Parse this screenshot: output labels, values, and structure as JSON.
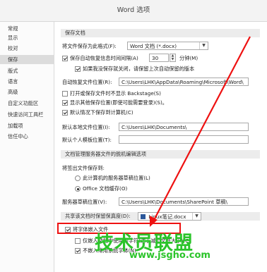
{
  "window": {
    "title": "Word 选项"
  },
  "sidebar": {
    "items": [
      {
        "label": "常规"
      },
      {
        "label": "显示"
      },
      {
        "label": "校对"
      },
      {
        "label": "保存"
      },
      {
        "label": "版式"
      },
      {
        "label": "语言"
      },
      {
        "label": "高级"
      },
      {
        "label": "自定义功能区"
      },
      {
        "label": "快速访问工具栏"
      },
      {
        "label": "加载项"
      },
      {
        "label": "信任中心"
      }
    ],
    "selected": "保存"
  },
  "save_docs": {
    "header": "保存文档",
    "format_label": "将文件保存为此格式(F):",
    "format_value": "Word 文档 (*.docx)",
    "autorecover_label": "保存自动恢复信息时间间隔(A)",
    "autorecover_minutes": "30",
    "minutes_unit": "分钟(M)",
    "keep_last_label": "如果我没保存就关闭，请保留上次自动保留的版本",
    "autorecover_loc_label": "自动恢复文件位置(R):",
    "autorecover_loc_value": "C:\\Users\\LHK\\AppData\\Roaming\\Microsoft\\Word\\",
    "no_backstage_label": "打开或保存文件时不显示 Backstage(S)",
    "show_other_locations_label": "显示其他保存位置(即使可能需要登录)(S)。",
    "default_to_computer_label": "默认情况下保存到计算机(C)",
    "default_local_label": "默认本地文件位置(I):",
    "default_local_value": "C:\\Users\\LHK\\Documents\\",
    "default_templates_label": "默认个人模板位置(T):",
    "default_templates_value": ""
  },
  "offline_editing": {
    "header": "文档管理服务器文件的脱机编辑选项",
    "save_checked_label": "将签出文件保存到:",
    "radio_server": "此计算机的服务器草稿位置(L)",
    "radio_office_cache": "Office 文档缓存(O)",
    "server_drafts_label": "服务器草稿位置(V):",
    "server_drafts_value": "C:\\Users\\LHK\\Documents\\SharePoint 草稿\\"
  },
  "fidelity": {
    "header": "共享该文档时保留保真度(D):",
    "doc_name": "Linux笔记.docx",
    "embed_fonts_label": "将字体嵌入文件",
    "embed_used_chars_label": "仅嵌入文档中使用的字符(适于减小文件大小)(C)",
    "no_common_fonts_label": "不嵌入常用系统字体(N)"
  },
  "watermark": {
    "text": "技术员联盟",
    "url": "www.jsgho.com"
  },
  "colors": {
    "annotation_red": "#e11111",
    "watermark_green": "#2bc42a"
  }
}
